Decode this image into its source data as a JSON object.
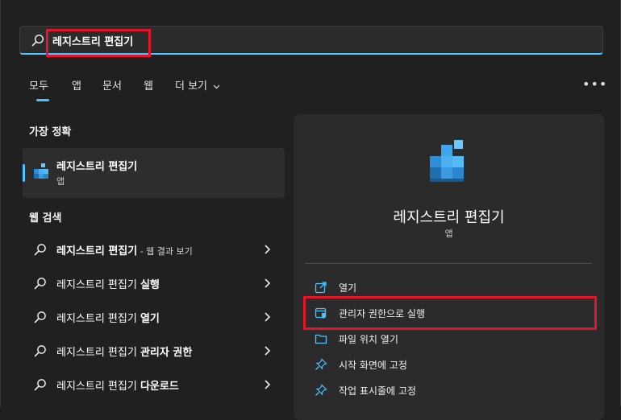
{
  "search": {
    "value": "레지스트리 편집기"
  },
  "tabs": [
    {
      "label": "모두"
    },
    {
      "label": "앱"
    },
    {
      "label": "문서"
    },
    {
      "label": "웹"
    },
    {
      "label": "더 보기"
    }
  ],
  "more_dots": "•••",
  "best_match": {
    "title": "가장 정확",
    "name": "레지스트리 편집기",
    "type": "앱"
  },
  "web_search": {
    "title": "웹 검색",
    "items": [
      {
        "prefix": "레지스트리 편집기",
        "suffix": " - 웹 결과 보기"
      },
      {
        "prefix": "레지스트리 편집기 ",
        "suffix": "실행"
      },
      {
        "prefix": "레지스트리 편집기 ",
        "suffix": "열기"
      },
      {
        "prefix": "레지스트리 편집기 ",
        "suffix": "관리자 권한"
      },
      {
        "prefix": "레지스트리 편집기 ",
        "suffix": "다운로드"
      }
    ]
  },
  "detail": {
    "name": "레지스트리 편집기",
    "type": "앱",
    "actions": [
      {
        "label": "열기",
        "icon": "open-icon"
      },
      {
        "label": "관리자 권한으로 실행",
        "icon": "shield-admin-icon"
      },
      {
        "label": "파일 위치 열기",
        "icon": "folder-icon"
      },
      {
        "label": "시작 화면에 고정",
        "icon": "pin-icon"
      },
      {
        "label": "작업 표시줄에 고정",
        "icon": "pin-icon"
      }
    ]
  },
  "colors": {
    "accent": "#4cc2ff",
    "highlight": "#e3152a",
    "background": "#202020",
    "panel": "#2b2b2b"
  }
}
